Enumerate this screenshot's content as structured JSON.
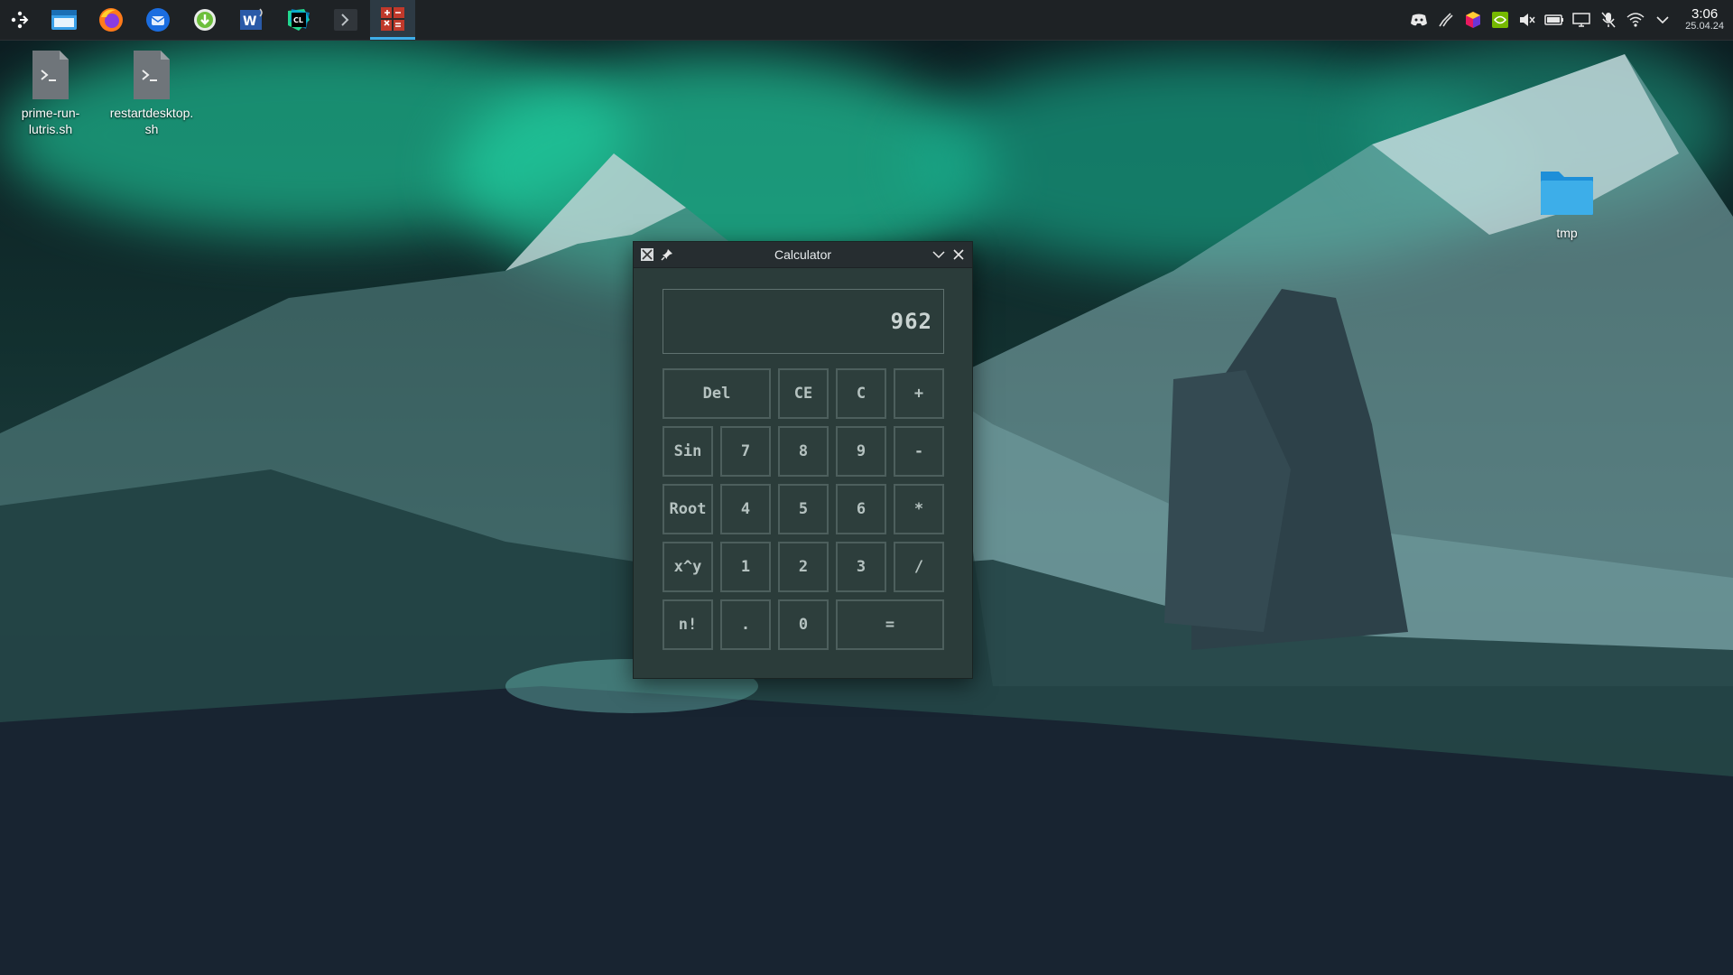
{
  "taskbar": {
    "launchers": [
      {
        "name": "application-launcher-icon"
      },
      {
        "name": "file-manager-icon"
      },
      {
        "name": "firefox-icon"
      },
      {
        "name": "thunderbird-icon"
      },
      {
        "name": "download-manager-icon"
      },
      {
        "name": "word-processor-icon"
      },
      {
        "name": "clion-icon"
      },
      {
        "name": "terminal-icon"
      },
      {
        "name": "calculator-app-icon"
      }
    ],
    "clock": {
      "time": "3:06",
      "date": "25.04.24"
    }
  },
  "desktop": {
    "icons": [
      {
        "label": "prime-run-\nlutris.sh",
        "type": "script"
      },
      {
        "label": "restartdesktop.\nsh",
        "type": "script"
      },
      {
        "label": "tmp",
        "type": "folder"
      }
    ]
  },
  "calculator": {
    "title": "Calculator",
    "display": "962",
    "keys": {
      "del": "Del",
      "ce": "CE",
      "c": "C",
      "plus": "+",
      "sin": "Sin",
      "k7": "7",
      "k8": "8",
      "k9": "9",
      "minus": "-",
      "root": "Root",
      "k4": "4",
      "k5": "5",
      "k6": "6",
      "multiply": "*",
      "power": "x^y",
      "k1": "1",
      "k2": "2",
      "k3": "3",
      "divide": "/",
      "factorial": "n!",
      "dot": ".",
      "k0": "0",
      "equals": "="
    }
  },
  "colors": {
    "accent": "#3daee9",
    "panel": "#1e2225",
    "calc_bg": "#2b3c3a",
    "key_border": "#4d5f5d"
  }
}
